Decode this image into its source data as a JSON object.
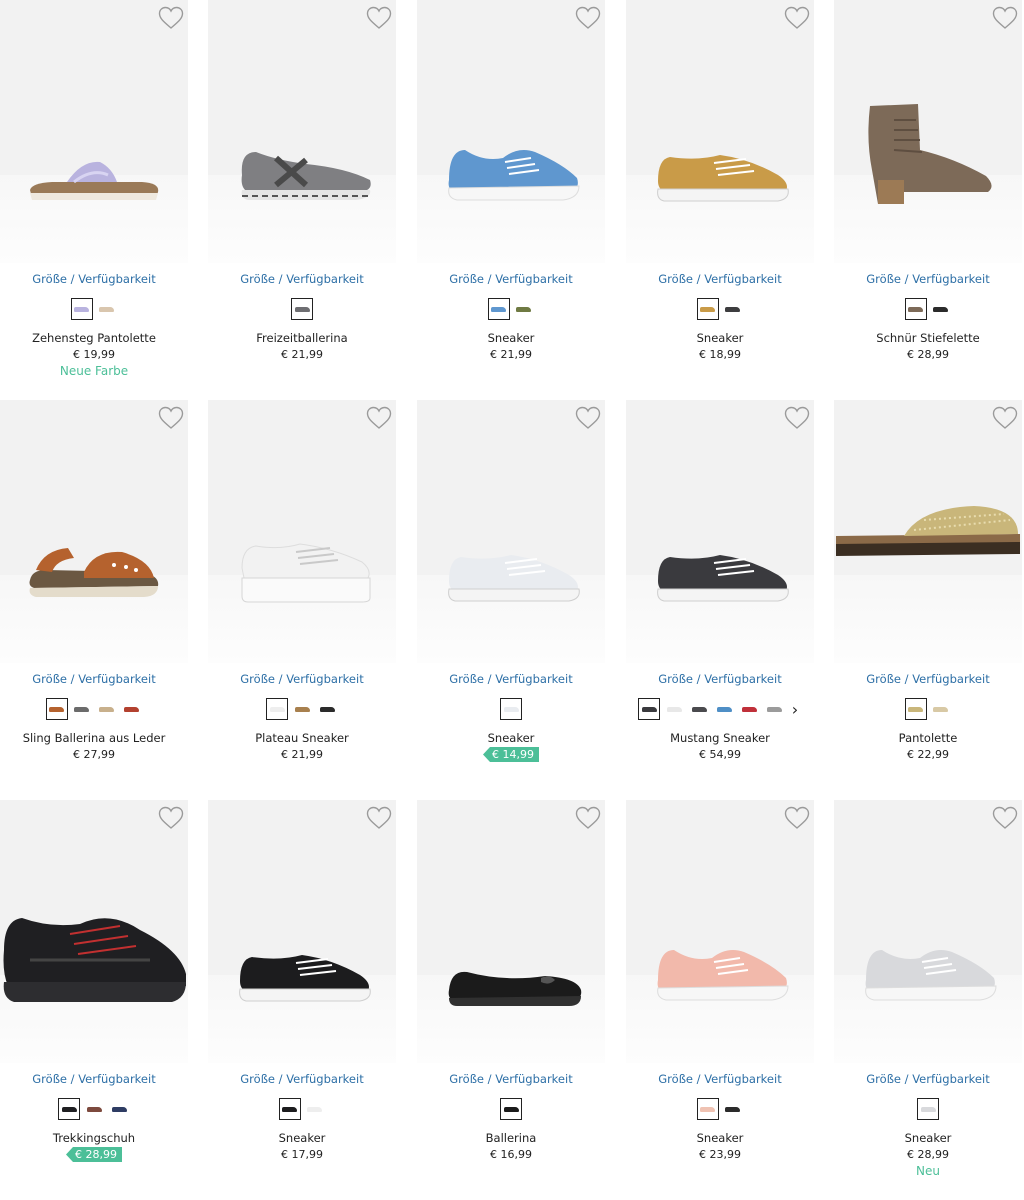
{
  "availability_label": "Größe / Verfügbarkeit",
  "colors": {
    "link": "#2d6fa6",
    "sale_badge": "#4cbf98",
    "extra_text": "#4cbf98"
  },
  "products": [
    {
      "name": "Zehensteg Pantolette",
      "price": "€ 19,99",
      "extra": "Neue Farbe",
      "sale": false,
      "shoe": "sandal",
      "main_color": "#b9b3df",
      "swatches": [
        "#b9b3df",
        "#d9c6ae"
      ]
    },
    {
      "name": "Freizeitballerina",
      "price": "€ 21,99",
      "extra": "",
      "sale": false,
      "shoe": "ballerina",
      "main_color": "#7f7f82",
      "swatches": [
        "#6e6e72"
      ]
    },
    {
      "name": "Sneaker",
      "price": "€ 21,99",
      "extra": "",
      "sale": false,
      "shoe": "sneaker",
      "main_color": "#5f97cf",
      "swatches": [
        "#5f97cf",
        "#6f7a43"
      ]
    },
    {
      "name": "Sneaker",
      "price": "€ 18,99",
      "extra": "",
      "sale": false,
      "shoe": "lowtop",
      "main_color": "#c99b48",
      "swatches": [
        "#c99b48",
        "#3d3d3f"
      ]
    },
    {
      "name": "Schnür Stiefelette",
      "price": "€ 28,99",
      "extra": "",
      "sale": false,
      "shoe": "boot",
      "main_color": "#7d6a58",
      "swatches": [
        "#7d6a58",
        "#2b2b2b"
      ]
    },
    {
      "name": "Sling Ballerina aus Leder",
      "price": "€ 27,99",
      "extra": "",
      "sale": false,
      "shoe": "slingsandal",
      "main_color": "#b5622e",
      "swatches": [
        "#b5622e",
        "#6b6b6b",
        "#c8b08c",
        "#b3412f"
      ]
    },
    {
      "name": "Plateau Sneaker",
      "price": "€ 21,99",
      "extra": "",
      "sale": false,
      "shoe": "platform",
      "main_color": "#f2f2f2",
      "swatches": [
        "#eeeeee",
        "#a8804e",
        "#2b2b2b"
      ]
    },
    {
      "name": "Sneaker",
      "price": "€ 14,99",
      "extra": "",
      "sale": true,
      "shoe": "lowtop",
      "main_color": "#e9ecf0",
      "swatches": [
        "#e9ecf0"
      ]
    },
    {
      "name": "Mustang Sneaker",
      "price": "€ 54,99",
      "extra": "",
      "sale": false,
      "shoe": "lowtop",
      "main_color": "#3a3a3e",
      "swatches": [
        "#3a3a3e",
        "#e8e8e8",
        "#4a4a4e",
        "#4f8fc6",
        "#c0303a",
        "#9b9b9b"
      ],
      "has_more": true
    },
    {
      "name": "Pantolette",
      "price": "€ 22,99",
      "extra": "",
      "sale": false,
      "shoe": "slide",
      "main_color": "#c9b67a",
      "swatches": [
        "#c9b67a",
        "#d8c9a5"
      ]
    },
    {
      "name": "Trekkingschuh",
      "price": "€ 28,99",
      "extra": "",
      "sale": true,
      "shoe": "trekking",
      "main_color": "#1f1f22",
      "swatches": [
        "#1f1f22",
        "#7d4a3e",
        "#2e3c63"
      ]
    },
    {
      "name": "Sneaker",
      "price": "€ 17,99",
      "extra": "",
      "sale": false,
      "shoe": "lowtop",
      "main_color": "#1c1c1e",
      "swatches": [
        "#1c1c1e",
        "#eeeeee"
      ]
    },
    {
      "name": "Ballerina",
      "price": "€ 16,99",
      "extra": "",
      "sale": false,
      "shoe": "flat",
      "main_color": "#1b1b1b",
      "swatches": [
        "#1b1b1b"
      ]
    },
    {
      "name": "Sneaker",
      "price": "€ 23,99",
      "extra": "",
      "sale": false,
      "shoe": "sneaker",
      "main_color": "#f2b9ab",
      "swatches": [
        "#efc2b2",
        "#2b2b2b"
      ]
    },
    {
      "name": "Sneaker",
      "price": "€ 28,99",
      "extra": "Neu",
      "sale": false,
      "shoe": "sneaker",
      "main_color": "#d8d9dc",
      "swatches": [
        "#d8d9dc"
      ]
    }
  ]
}
